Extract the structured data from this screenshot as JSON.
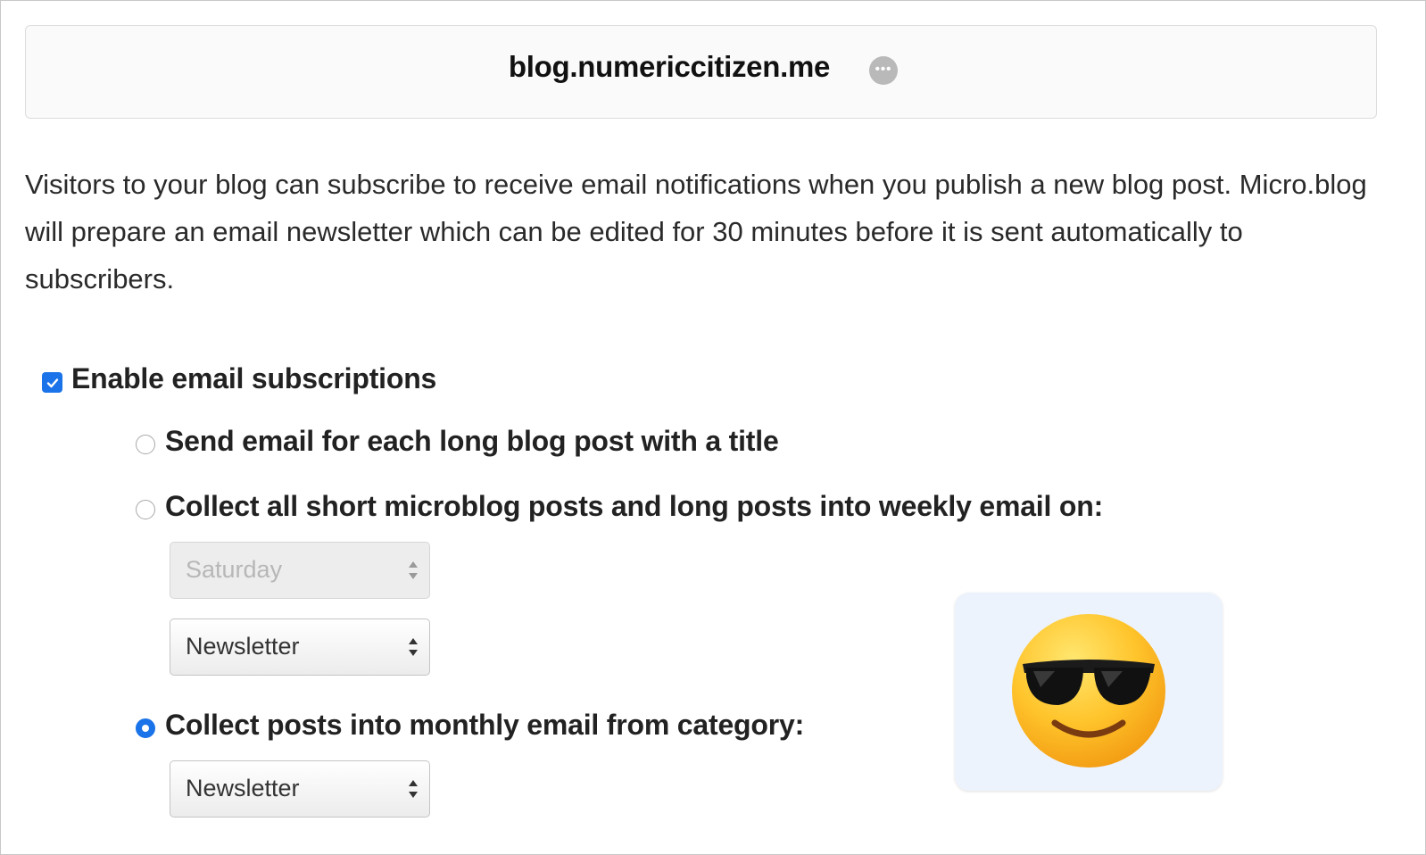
{
  "header": {
    "site_title": "blog.numericcitizen.me",
    "more_icon": "ellipsis-circle-icon"
  },
  "intro_text": "Visitors to your blog can subscribe to receive email notifications when you publish a new blog post. Micro.blog will prepare an email newsletter which can be edited for 30 minutes before it is sent automatically to subscribers.",
  "enable_subscriptions": {
    "label": "Enable email subscriptions",
    "checked": true
  },
  "options": [
    {
      "label": "Send email for each long blog post with a title",
      "selected": false
    },
    {
      "label": "Collect all short microblog posts and long posts into weekly email on:",
      "selected": false
    },
    {
      "label": "Collect posts into monthly email from category:",
      "selected": true
    }
  ],
  "weekly_day_select": {
    "value": "Saturday",
    "disabled": true
  },
  "weekly_category_select": {
    "value": "Newsletter",
    "disabled": false
  },
  "monthly_category_select": {
    "value": "Newsletter",
    "disabled": false
  },
  "emoji_card": {
    "icon": "smiling-face-with-sunglasses-icon"
  },
  "colors": {
    "accent": "#1a73e8",
    "emoji_card_bg": "#edf3fc"
  }
}
